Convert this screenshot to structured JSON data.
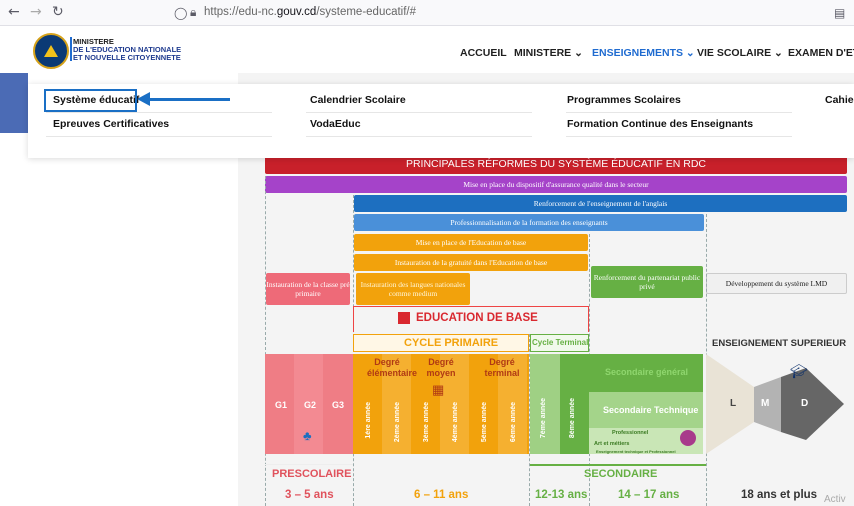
{
  "browser": {
    "back_icon": "arrow-left-icon",
    "forward_icon": "arrow-right-icon",
    "reload_icon": "reload-icon",
    "url_prefix": "https://edu-nc.",
    "url_domain": "gouv.cd",
    "url_path": "/systeme-educatif/#"
  },
  "header": {
    "ministry_line1": "MINISTERE",
    "ministry_line2": "DE L'EDUCATION NATIONALE",
    "ministry_line3": "ET NOUVELLE CITOYENNETE",
    "nav": [
      {
        "label": "ACCUEIL"
      },
      {
        "label": "MINISTERE ⌄"
      },
      {
        "label": "ENSEIGNEMENTS ⌄"
      },
      {
        "label": "VIE SCOLAIRE ⌄"
      },
      {
        "label": "EXAMEN D'ETA"
      }
    ]
  },
  "dropdown": {
    "col1": [
      "Système éducatif",
      "Epreuves Certificatives"
    ],
    "col2": [
      "Calendrier Scolaire",
      "VodaEduc"
    ],
    "col3": [
      "Programmes Scolaires",
      "Formation Continue des Enseignants"
    ],
    "col4": [
      "Cahie"
    ]
  },
  "infographic": {
    "title": "PRINCIPALES RÉFORMES DU SYSTÈME ÉDUCATIF EN RDC",
    "bars": [
      "Mise en place du dispositif d'assurance qualité dans le secteur",
      "Renforcement de l'enseignement de l'anglais",
      "Professionnalisation de la formation des enseignants",
      "Mise en place de l'Education de base",
      "Instauration de la gratuité dans l'Education de base",
      "Instauration de la classe pré primaire",
      "Instauration des langues nationales comme medium",
      "Renforcement du partenariat public privé",
      "Développement du système LMD"
    ],
    "education_de_base": "EDUCATION DE BASE",
    "cycle_primaire": "CYCLE PRIMAIRE",
    "cycle_terminal": "Cycle Terminal",
    "enseignement_superieur": "ENSEIGNEMENT SUPERIEUR",
    "degres": [
      "Degré élémentaire",
      "Degré moyen",
      "Degré terminal"
    ],
    "prescolaire_grades": [
      "G1",
      "G2",
      "G3"
    ],
    "primaire_years": [
      "1ère année",
      "2ème année",
      "3ème année",
      "4ème année",
      "5ème année",
      "6ème année"
    ],
    "terminal_years": [
      "7ème année",
      "8ème année"
    ],
    "secondaire_general": "Secondaire général",
    "secondaire_technique": "Secondaire Technique",
    "professionnel": "Professionnel",
    "arts_metiers": "Art et métiers",
    "enseignement_tech": "Enseignement technique et Professionnel",
    "lmd": [
      "L",
      "M",
      "D"
    ],
    "prescolaire_label": "PRESCOLAIRE",
    "secondaire_label": "SECONDAIRE",
    "ages": [
      "3 – 5 ans",
      "6 – 11 ans",
      "12-13 ans",
      "14 – 17 ans",
      "18 ans et plus"
    ],
    "watermark": "Activ"
  },
  "colors": {
    "highlight": "#1a6fc5",
    "red": "#c8202a",
    "purple": "#a543c9",
    "blue": "#1d6fc0",
    "lightblue": "#4a90d9",
    "orange": "#f2a20c",
    "pink": "#ee6a78",
    "green": "#66b044",
    "nav_active": "#1f6bd0"
  }
}
